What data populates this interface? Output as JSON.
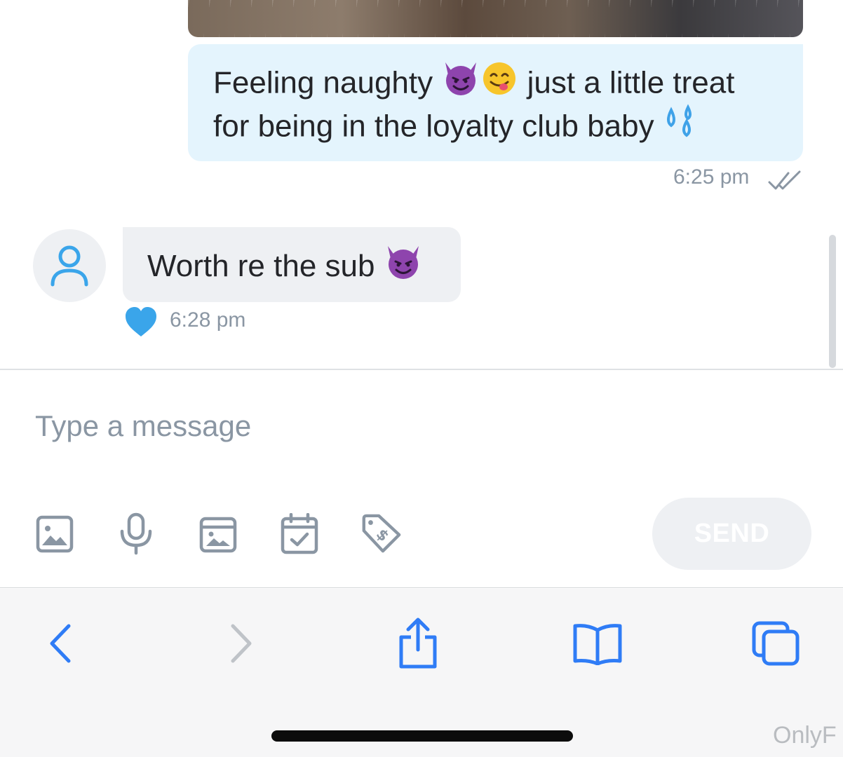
{
  "sent_message": {
    "line1_before": "Feeling naughty ",
    "line1_after": " just a little treat",
    "line2": "for being in the loyalty club baby ",
    "emojis": [
      "smiling-devil",
      "yum-face",
      "sweat-droplets"
    ],
    "time": "6:25 pm",
    "read_status_icon": "double-check-icon"
  },
  "received_message": {
    "text": "Worth re the sub ",
    "emoji": "smiling-devil",
    "time": "6:28 pm",
    "liked": true
  },
  "composer": {
    "placeholder": "Type a message",
    "send_label": "SEND",
    "tools": [
      "image-icon",
      "microphone-icon",
      "media-vault-icon",
      "schedule-icon",
      "price-tag-icon"
    ]
  },
  "browser_toolbar": {
    "items": [
      "back-icon",
      "forward-icon",
      "share-icon",
      "bookmarks-icon",
      "tabs-icon"
    ]
  },
  "watermark": "OnlyF",
  "colors": {
    "accent": "#00aff0",
    "sent_bubble": "#e4f4fd",
    "received_bubble": "#eef0f3",
    "muted_text": "#8a96a3",
    "safari_blue": "#2f7cf6"
  }
}
